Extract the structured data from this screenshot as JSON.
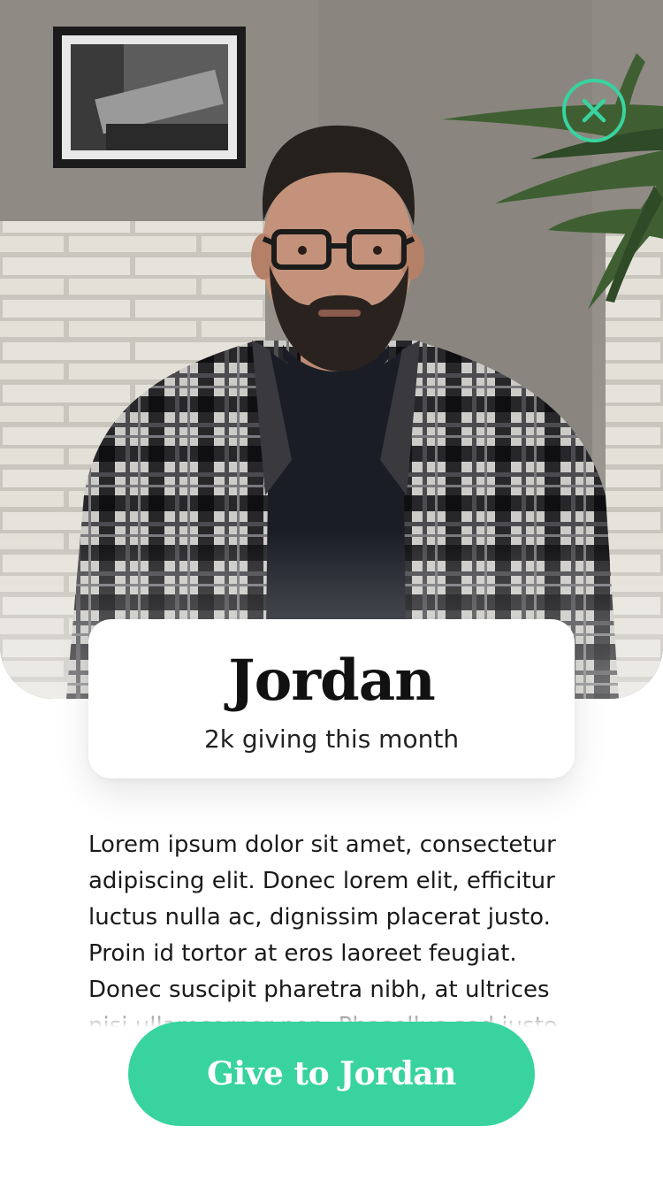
{
  "profile": {
    "name": "Jordan",
    "giving_summary": "2k giving this month",
    "bio": "Lorem ipsum dolor sit amet, consectetur adipiscing elit. Donec lorem elit, efficitur luctus nulla ac, dignissim placerat justo. Proin id tortor at eros laoreet feugiat. Donec suscipit pharetra nibh, at ultrices nisi ullamcorper non. Phasellus sed justo."
  },
  "actions": {
    "give_label": "Give to Jordan",
    "close_icon": "close-icon"
  },
  "colors": {
    "accent": "#38d39f",
    "text": "#111111",
    "background": "#ffffff"
  }
}
